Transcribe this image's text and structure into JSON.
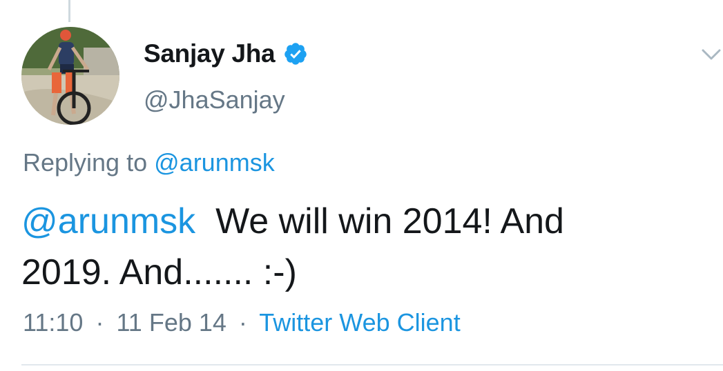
{
  "tweet": {
    "author": {
      "display_name": "Sanjay Jha",
      "handle": "@JhaSanjay",
      "verified": true
    },
    "replying_label": "Replying to",
    "replying_to": "@arunmsk",
    "text_mention": "@arunmsk",
    "text_body_line1": "We will win 2014! And",
    "text_body_line2": "2019. And....... :-)",
    "time": "11:10",
    "date": "11 Feb 14",
    "separator": "·",
    "client": "Twitter Web Client"
  },
  "icons": {
    "verified": "verified-badge-icon",
    "menu": "chevron-down-icon"
  },
  "colors": {
    "link": "#1b95e0",
    "secondary_text": "#657786",
    "primary_text": "#14171a",
    "divider": "#e1e8ed"
  }
}
